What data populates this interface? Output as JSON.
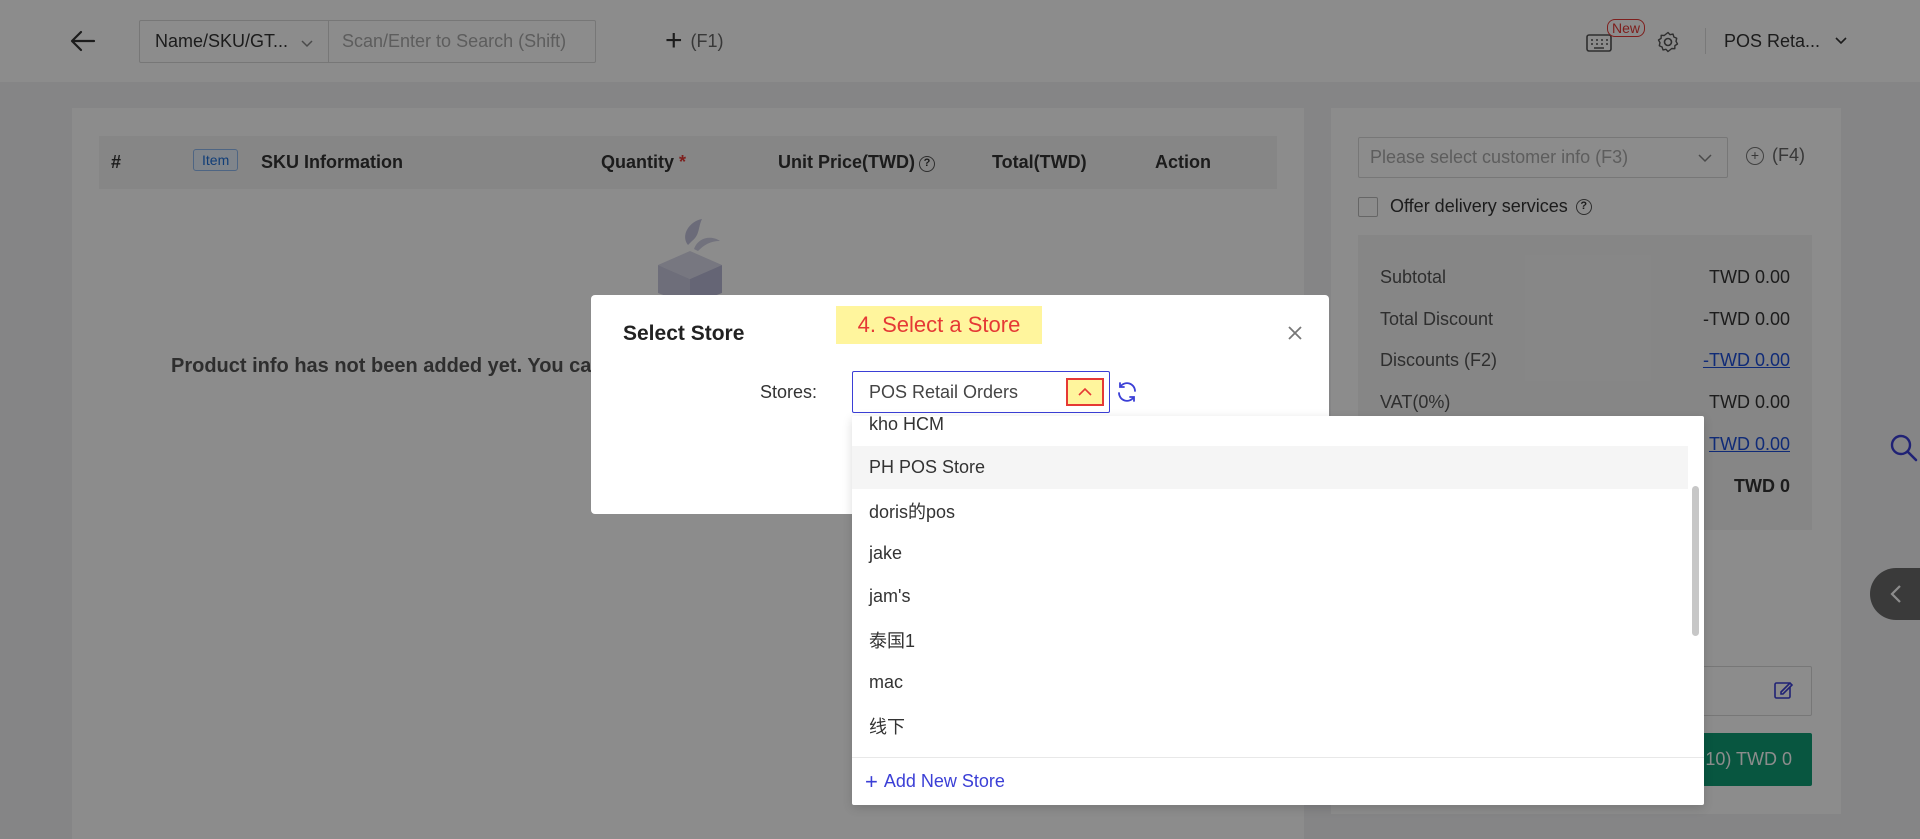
{
  "topbar": {
    "search_type": "Name/SKU/GT...",
    "search_placeholder": "Scan/Enter to Search (Shift)",
    "add_shortcut": "(F1)",
    "new_badge": "New",
    "store_name": "POS Reta..."
  },
  "table": {
    "col_index": "#",
    "item_tag": "Item",
    "col_sku": "SKU Information",
    "col_quantity": "Quantity",
    "required_mark": "*",
    "col_unit_price": "Unit Price(TWD)",
    "col_total": "Total(TWD)",
    "col_action": "Action",
    "empty_text": "Product info has not been added yet. You ca"
  },
  "customer": {
    "placeholder": "Please select customer info (F3)",
    "add_shortcut": "(F4)",
    "delivery_label": "Offer delivery services"
  },
  "summary": {
    "rows": [
      {
        "label": "Subtotal",
        "value": "TWD 0.00"
      },
      {
        "label": "Total Discount",
        "value": "-TWD 0.00"
      },
      {
        "label": "Discounts (F2)",
        "value": "-TWD 0.00"
      },
      {
        "label": "VAT(0%)",
        "value": "TWD 0.00"
      },
      {
        "label": "",
        "value": "TWD 0.00"
      },
      {
        "label": "",
        "value": "TWD 0"
      }
    ],
    "checkout_label": "10) TWD 0"
  },
  "modal": {
    "title": "Select Store",
    "step_note": "4. Select a Store",
    "stores_label": "Stores",
    "stores_colon": ":",
    "selected_store": "POS Retail Orders"
  },
  "dropdown": {
    "options": [
      "kho HCM",
      "PH POS Store",
      "doris的pos",
      "jake",
      "jam's",
      "泰国1",
      "mac",
      "线下"
    ],
    "active_option": "PH POS Store",
    "add_new_label": "Add New Store"
  },
  "colors": {
    "accent": "#3b3fd6",
    "checkout_green": "#0f9d75",
    "highlight_yellow": "#fff59d",
    "highlight_red": "#e53935"
  }
}
